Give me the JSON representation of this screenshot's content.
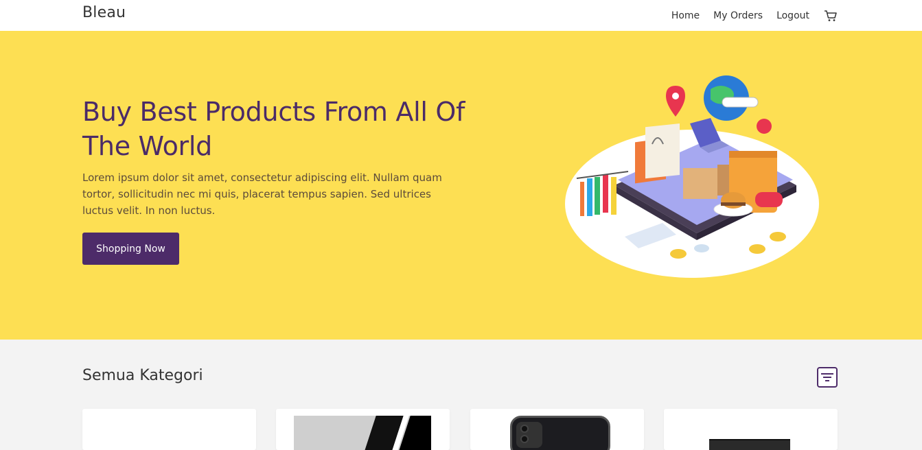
{
  "navbar": {
    "brand": "Bleau",
    "links": [
      "Home",
      "My Orders",
      "Logout"
    ],
    "cart_icon": "shopping-cart-icon"
  },
  "hero": {
    "title": "Buy Best Products From All Of The World",
    "description": "Lorem ipsum dolor sit amet, consectetur adipiscing elit. Nullam quam tortor, sollicitudin nec mi quis, placerat tempus sapien. Sed ultrices luctus velit. In non luctus.",
    "cta_label": "Shopping Now",
    "illustration": "online-shopping-illustration"
  },
  "category_section": {
    "title": "Semua Kategori",
    "filter_icon": "filter-icon"
  },
  "product_cards": [
    {
      "image": "blank"
    },
    {
      "image": "product-photo-dark-stripes"
    },
    {
      "image": "smartphone-black"
    },
    {
      "image": "laptop-dark"
    }
  ],
  "colors": {
    "hero_bg": "#fddf53",
    "accent_purple": "#4d2b69",
    "page_bg": "#f3f3f3"
  }
}
